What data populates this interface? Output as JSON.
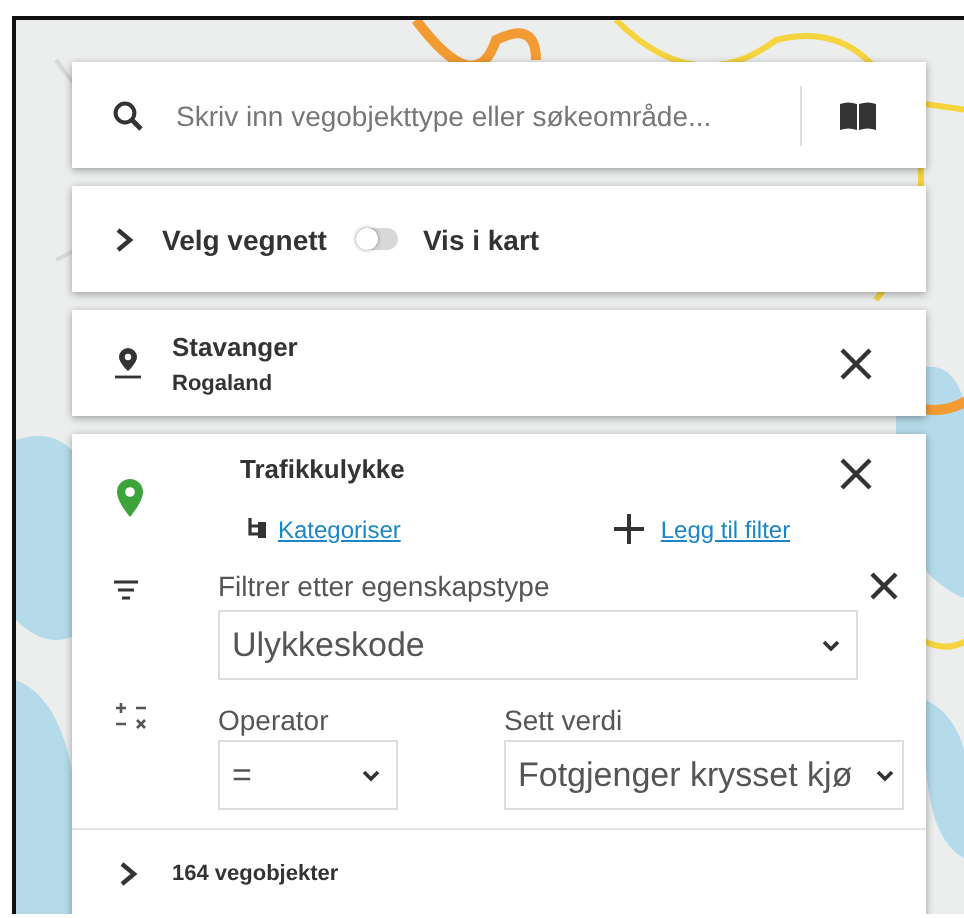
{
  "search": {
    "placeholder": "Skriv inn vegobjekttype eller søkeområde..."
  },
  "network": {
    "label": "Velg vegnett",
    "expanded": false,
    "toggle": {
      "label": "Vis i kart",
      "on": false
    }
  },
  "area": {
    "name": "Stavanger",
    "region": "Rogaland"
  },
  "layer": {
    "name": "Trafikkulykke",
    "categorize_link": "Kategoriser",
    "add_filter_link": "Legg til filter",
    "filter": {
      "label": "Filtrer etter egenskapstype",
      "property": "Ulykkeskode",
      "operator_label": "Operator",
      "operator": "=",
      "value_label": "Sett verdi",
      "value": "Fotgjenger krysset kjø"
    },
    "results": {
      "label": "164 vegobjekter",
      "expanded": false
    }
  }
}
